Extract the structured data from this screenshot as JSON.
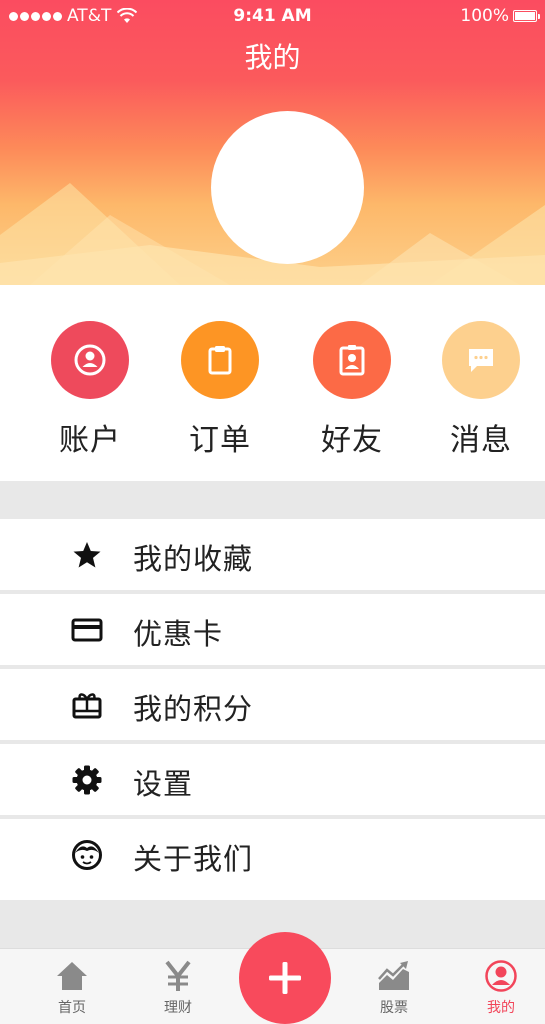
{
  "status_bar": {
    "carrier": "AT&T",
    "time": "9:41 AM",
    "battery": "100%"
  },
  "header": {
    "title": "我的"
  },
  "quick_actions": [
    {
      "label": "账户",
      "icon": "account-icon",
      "color": "#ee4a5c"
    },
    {
      "label": "订单",
      "icon": "clipboard-icon",
      "color": "#fd9524"
    },
    {
      "label": "好友",
      "icon": "contact-badge-icon",
      "color": "#fc6a46"
    },
    {
      "label": "消息",
      "icon": "message-bubble-icon",
      "color": "#fdd08e"
    }
  ],
  "menu": [
    {
      "label": "我的收藏",
      "icon": "star-icon"
    },
    {
      "label": "优惠卡",
      "icon": "credit-card-icon"
    },
    {
      "label": "我的积分",
      "icon": "gift-icon"
    },
    {
      "label": "设置",
      "icon": "gear-icon"
    },
    {
      "label": "关于我们",
      "icon": "face-icon"
    }
  ],
  "tabbar": [
    {
      "label": "首页",
      "icon": "home-icon"
    },
    {
      "label": "理财",
      "icon": "yen-icon"
    },
    {
      "label": "股票",
      "icon": "stock-chart-icon"
    },
    {
      "label": "我的",
      "icon": "profile-icon",
      "active": true
    }
  ],
  "colors": {
    "accent": "#f84a5c",
    "header_top": "#fb4c60",
    "header_bottom": "#fdd08a"
  }
}
